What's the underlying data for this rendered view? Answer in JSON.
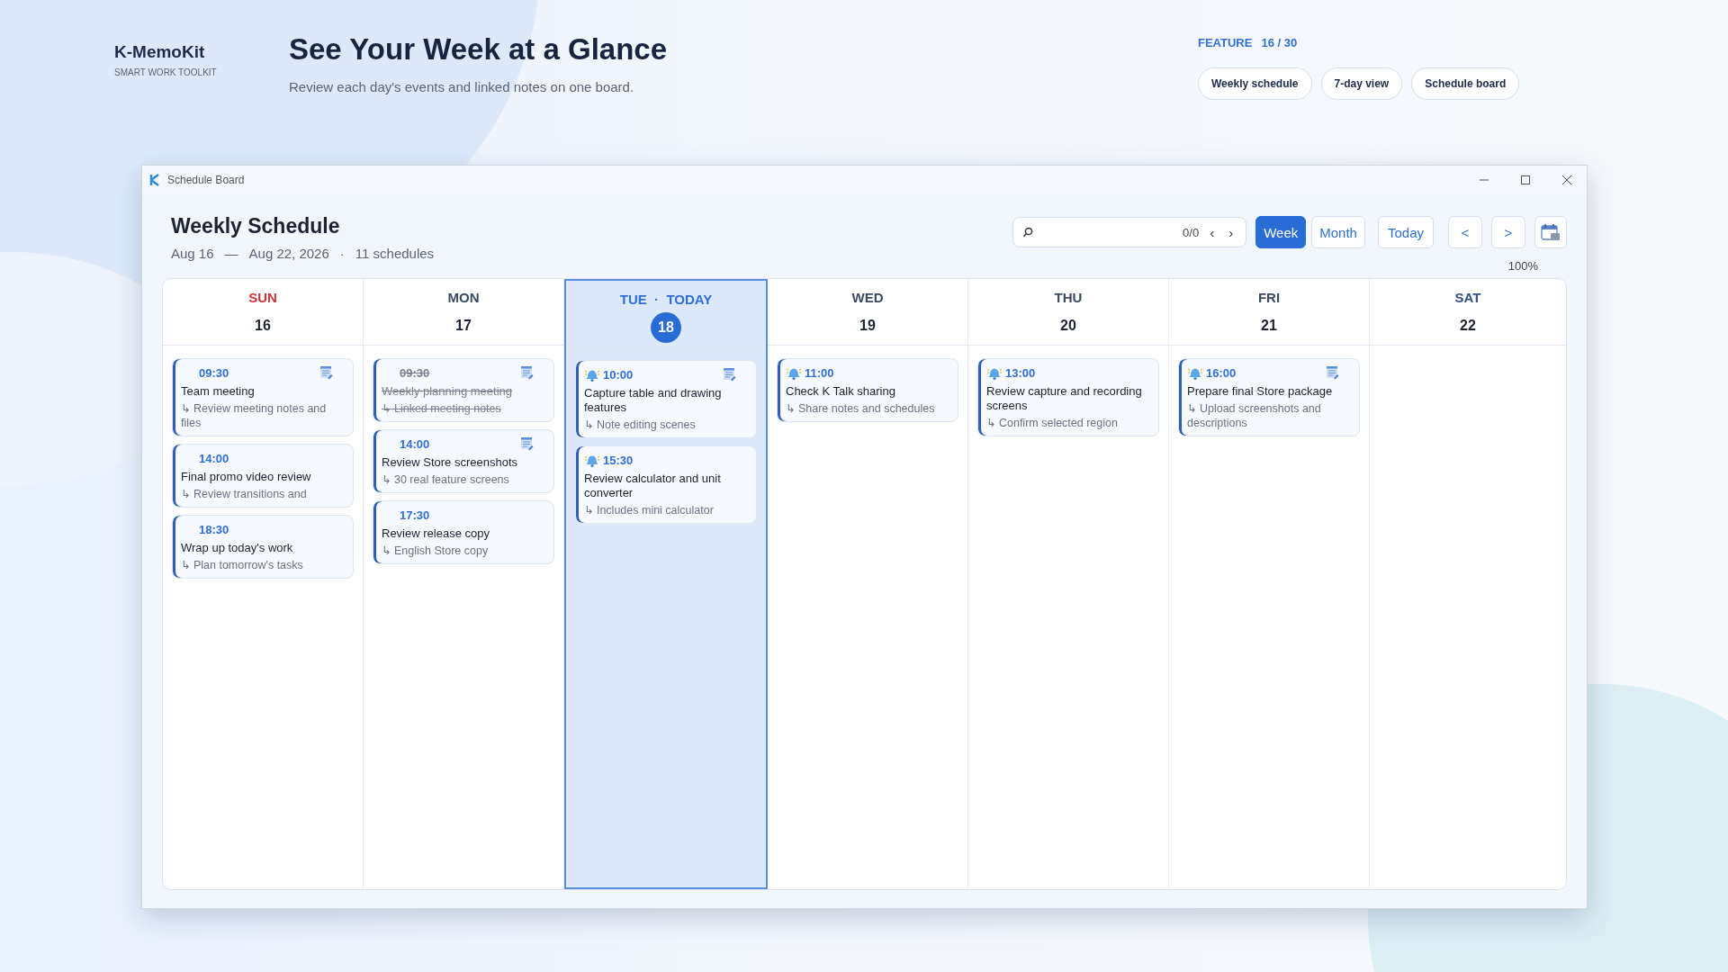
{
  "brand": {
    "name": "K-MemoKit",
    "tagline": "SMART WORK TOOLKIT"
  },
  "hero": {
    "title": "See Your Week at a Glance",
    "subtitle": "Review each day's events and linked notes on one board."
  },
  "feature": {
    "label": "FEATURE",
    "count": "16 / 30",
    "tags": [
      "Weekly schedule",
      "7-day view",
      "Schedule board"
    ]
  },
  "window": {
    "title": "Schedule Board"
  },
  "schedule": {
    "title": "Weekly Schedule",
    "range_start": "Aug 16",
    "range_sep": "—",
    "range_end": "Aug 22, 2026",
    "dot": "·",
    "count": "11 schedules"
  },
  "search": {
    "count": "0/0",
    "prev": "‹",
    "next": "›"
  },
  "views": [
    {
      "label": "Week",
      "selected": true
    },
    {
      "label": "Month",
      "selected": false
    }
  ],
  "nav": {
    "today": "Today",
    "prev": "<",
    "next": ">",
    "zoom": "100%"
  },
  "days": [
    {
      "name": "SUN",
      "date": "16",
      "selected": false,
      "color": "#c8353a",
      "events": [
        {
          "time": "09:30",
          "title": "Team meeting",
          "note": "↳ Review meeting notes and files",
          "alarm": false,
          "memo": true,
          "done": false
        },
        {
          "time": "14:00",
          "title": "Final promo video review",
          "note": "↳ Review transitions and",
          "alarm": false,
          "memo": false,
          "done": false
        },
        {
          "time": "18:30",
          "title": "Wrap up today's work",
          "note": "↳ Plan tomorrow's tasks",
          "alarm": false,
          "memo": false,
          "done": false
        }
      ]
    },
    {
      "name": "MON",
      "date": "17",
      "selected": false,
      "color": "#3b4a63",
      "events": [
        {
          "time": "09:30",
          "title": "Weekly planning meeting",
          "note": "↳ Linked meeting notes",
          "alarm": false,
          "memo": true,
          "done": true
        },
        {
          "time": "14:00",
          "title": "Review Store screenshots",
          "note": "↳ 30 real feature screens",
          "alarm": false,
          "memo": true,
          "done": false
        },
        {
          "time": "17:30",
          "title": "Review release copy",
          "note": "↳ English Store copy",
          "alarm": false,
          "memo": false,
          "done": false
        }
      ]
    },
    {
      "name": "TUE  ·  TODAY",
      "date": "18",
      "selected": true,
      "color": "#2f6fd6",
      "events": [
        {
          "time": "10:00",
          "title": "Capture table and drawing features",
          "note": "↳ Note editing scenes",
          "alarm": true,
          "memo": true,
          "done": false
        },
        {
          "time": "15:30",
          "title": "Review calculator and unit converter",
          "note": "↳ Includes mini calculator",
          "alarm": true,
          "memo": false,
          "done": false
        }
      ]
    },
    {
      "name": "WED",
      "date": "19",
      "selected": false,
      "color": "#3b4a63",
      "events": [
        {
          "time": "11:00",
          "title": "Check K Talk sharing",
          "note": "↳ Share notes and schedules",
          "alarm": true,
          "memo": false,
          "done": false
        }
      ]
    },
    {
      "name": "THU",
      "date": "20",
      "selected": false,
      "color": "#3b4a63",
      "events": [
        {
          "time": "13:00",
          "title": "Review capture and recording screens",
          "note": "↳ Confirm selected region",
          "alarm": true,
          "memo": false,
          "done": false
        }
      ]
    },
    {
      "name": "FRI",
      "date": "21",
      "selected": false,
      "color": "#3b4a63",
      "events": [
        {
          "time": "16:00",
          "title": "Prepare final Store package",
          "note": "↳ Upload screenshots and descriptions",
          "alarm": true,
          "memo": true,
          "done": false
        }
      ]
    },
    {
      "name": "SAT",
      "date": "22",
      "selected": false,
      "color": "#33517e"
    }
  ]
}
